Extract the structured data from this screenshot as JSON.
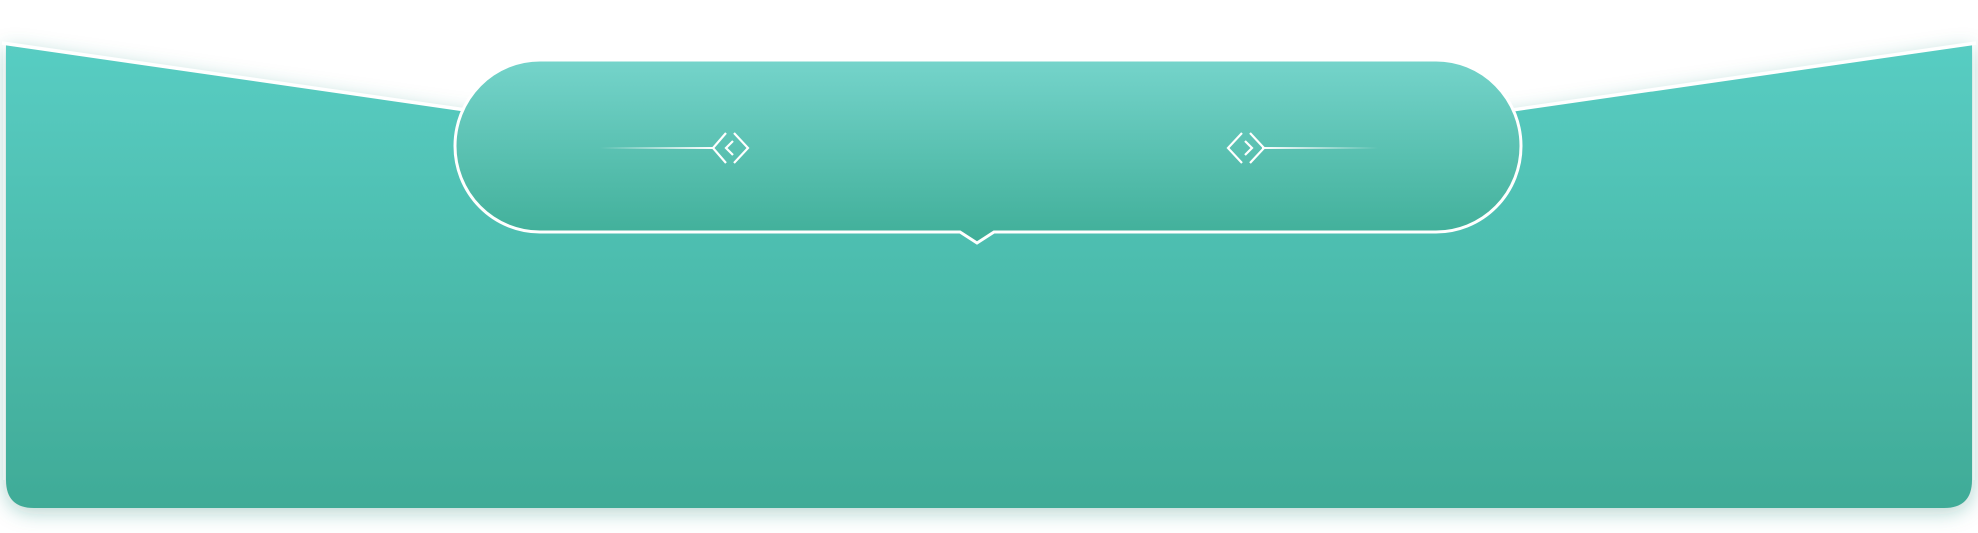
{
  "banner": {
    "title": "",
    "colors": {
      "panel_top": "#58cdc3",
      "panel_bottom": "#41ab98",
      "pill_top": "#74d3ca",
      "pill_bottom": "#3fae98",
      "outline": "#ffffff"
    },
    "icons": {
      "left_ornament": "diamond-chevron-ornament-icon",
      "right_ornament": "diamond-chevron-ornament-icon"
    }
  }
}
